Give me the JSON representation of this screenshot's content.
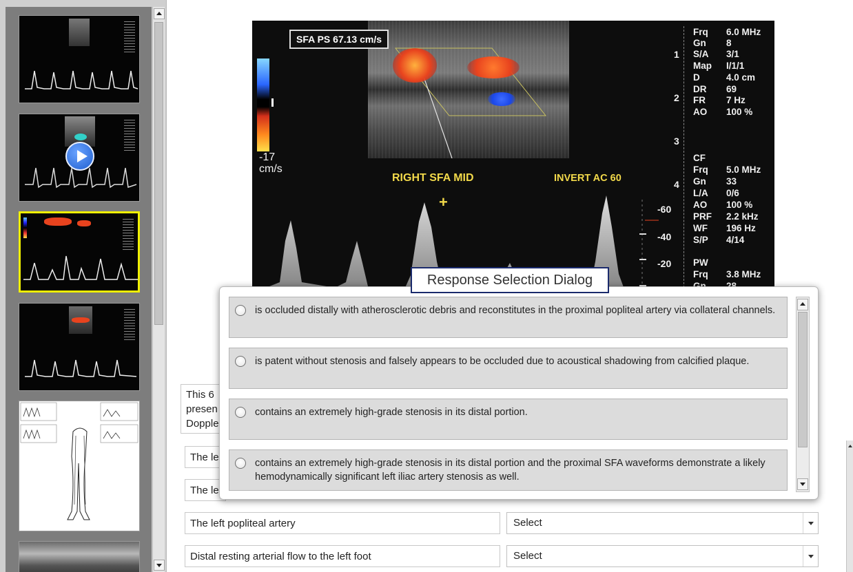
{
  "ultrasound": {
    "psv_label": "SFA PS  67.13 cm/s",
    "scale_value": "-17",
    "scale_unit": "cm/s",
    "location_label": "RIGHT SFA MID",
    "invert_label": "INVERT AC 60",
    "velocity_ticks": [
      "-60",
      "-40",
      "-20"
    ],
    "depth_marks": [
      "1",
      "2",
      "3",
      "4"
    ],
    "params_top": [
      {
        "k": "Frq",
        "v": "6.0 MHz"
      },
      {
        "k": "Gn",
        "v": "8"
      },
      {
        "k": "S/A",
        "v": "3/1"
      },
      {
        "k": "Map",
        "v": "I/1/1"
      },
      {
        "k": "D",
        "v": "4.0 cm"
      },
      {
        "k": "DR",
        "v": "69"
      },
      {
        "k": "FR",
        "v": "7 Hz"
      },
      {
        "k": "AO",
        "v": "100 %"
      }
    ],
    "cf_heading": "CF",
    "params_cf": [
      {
        "k": "Frq",
        "v": "5.0 MHz"
      },
      {
        "k": "Gn",
        "v": "33"
      },
      {
        "k": "L/A",
        "v": "0/6"
      },
      {
        "k": "AO",
        "v": "100 %"
      },
      {
        "k": "PRF",
        "v": "2.2 kHz"
      },
      {
        "k": "WF",
        "v": "196 Hz"
      },
      {
        "k": "S/P",
        "v": "4/14"
      }
    ],
    "pw_heading": "PW",
    "params_pw": [
      {
        "k": "Frq",
        "v": "3.8 MHz"
      },
      {
        "k": "Gn",
        "v": "28"
      }
    ],
    "colors": {
      "flow_red": "#e8431e",
      "flow_blue": "#1b47e8",
      "label_yellow": "#f2d94a"
    }
  },
  "question": {
    "stem_lines": [
      "This 6",
      "presen",
      "Dopple"
    ],
    "rows": [
      {
        "label": "The le"
      },
      {
        "label": "The le"
      },
      {
        "label": "The left popliteal artery",
        "select": "Select"
      },
      {
        "label": "Distal resting arterial flow to the left foot",
        "select": "Select"
      }
    ]
  },
  "dialog": {
    "title": "Response Selection Dialog",
    "options": [
      {
        "text": "is occluded distally with atherosclerotic debris and reconstitutes in the proximal  popliteal artery via collateral channels."
      },
      {
        "text": "is patent without stenosis and falsely appears to be occluded due to acoustical shadowing from calcified plaque."
      },
      {
        "text": "contains an extremely high-grade stenosis in its distal portion."
      },
      {
        "text": "contains an extremely high-grade stenosis in its distal portion and the proximal SFA waveforms demonstrate a likely hemodynamically significant left iliac artery stenosis as well."
      }
    ]
  },
  "thumbnails": {
    "count": 6,
    "selected_index": 2,
    "second_has_play_icon": "play-icon"
  }
}
